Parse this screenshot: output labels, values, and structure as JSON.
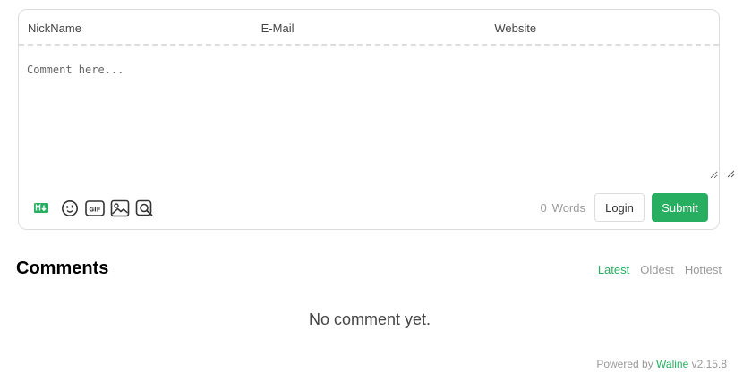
{
  "form": {
    "nickname_placeholder": "NickName",
    "email_placeholder": "E-Mail",
    "website_placeholder": "Website",
    "comment_placeholder": "Comment here...",
    "word_count": "0",
    "word_unit": "Words",
    "login_label": "Login",
    "submit_label": "Submit",
    "toolbar_icons": [
      "markdown-icon",
      "emoji-icon",
      "gif-icon",
      "image-icon",
      "preview-icon"
    ]
  },
  "comments": {
    "title": "Comments",
    "sort_options": [
      "Latest",
      "Oldest",
      "Hottest"
    ],
    "active_sort": "Latest",
    "empty_message": "No comment yet."
  },
  "footer": {
    "powered_prefix": "Powered by",
    "brand": "Waline",
    "version": "v2.15.8"
  },
  "colors": {
    "accent": "#27ae60",
    "border": "#dddddd",
    "muted": "#999999"
  }
}
